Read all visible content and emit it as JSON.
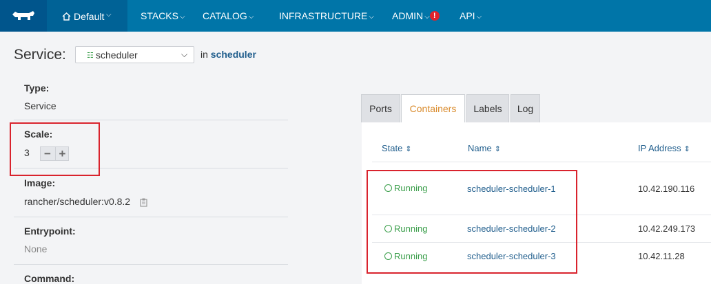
{
  "nav": {
    "logo": "rancher-cow-logo",
    "environment": "Default",
    "items": [
      {
        "label": "STACKS"
      },
      {
        "label": "CATALOG"
      },
      {
        "label": "INFRASTRUCTURE"
      },
      {
        "label": "ADMIN",
        "alert": "!"
      },
      {
        "label": "API"
      }
    ]
  },
  "service": {
    "label": "Service:",
    "selected": "scheduler",
    "in_prefix": "in",
    "stack": "scheduler"
  },
  "info": {
    "type_label": "Type:",
    "type_value": "Service",
    "scale_label": "Scale:",
    "scale_value": "3",
    "image_label": "Image:",
    "image_value": "rancher/scheduler:v0.8.2",
    "entrypoint_label": "Entrypoint:",
    "entrypoint_value": "None",
    "command_label": "Command:"
  },
  "tabs": [
    {
      "label": "Ports"
    },
    {
      "label": "Containers",
      "active": true
    },
    {
      "label": "Labels"
    },
    {
      "label": "Log"
    }
  ],
  "table": {
    "headers": {
      "state": "State",
      "name": "Name",
      "ip": "IP Address"
    },
    "rows": [
      {
        "state": "Running",
        "name": "scheduler-scheduler-1",
        "ip": "10.42.190.116"
      },
      {
        "state": "Running",
        "name": "scheduler-scheduler-2",
        "ip": "10.42.249.173"
      },
      {
        "state": "Running",
        "name": "scheduler-scheduler-3",
        "ip": "10.42.11.28"
      }
    ]
  },
  "colors": {
    "nav_bg": "#0075a8",
    "running": "#3a9e4a",
    "link": "#1f5d8c",
    "active_tab": "#d98a2b",
    "highlight": "#d9232d"
  }
}
